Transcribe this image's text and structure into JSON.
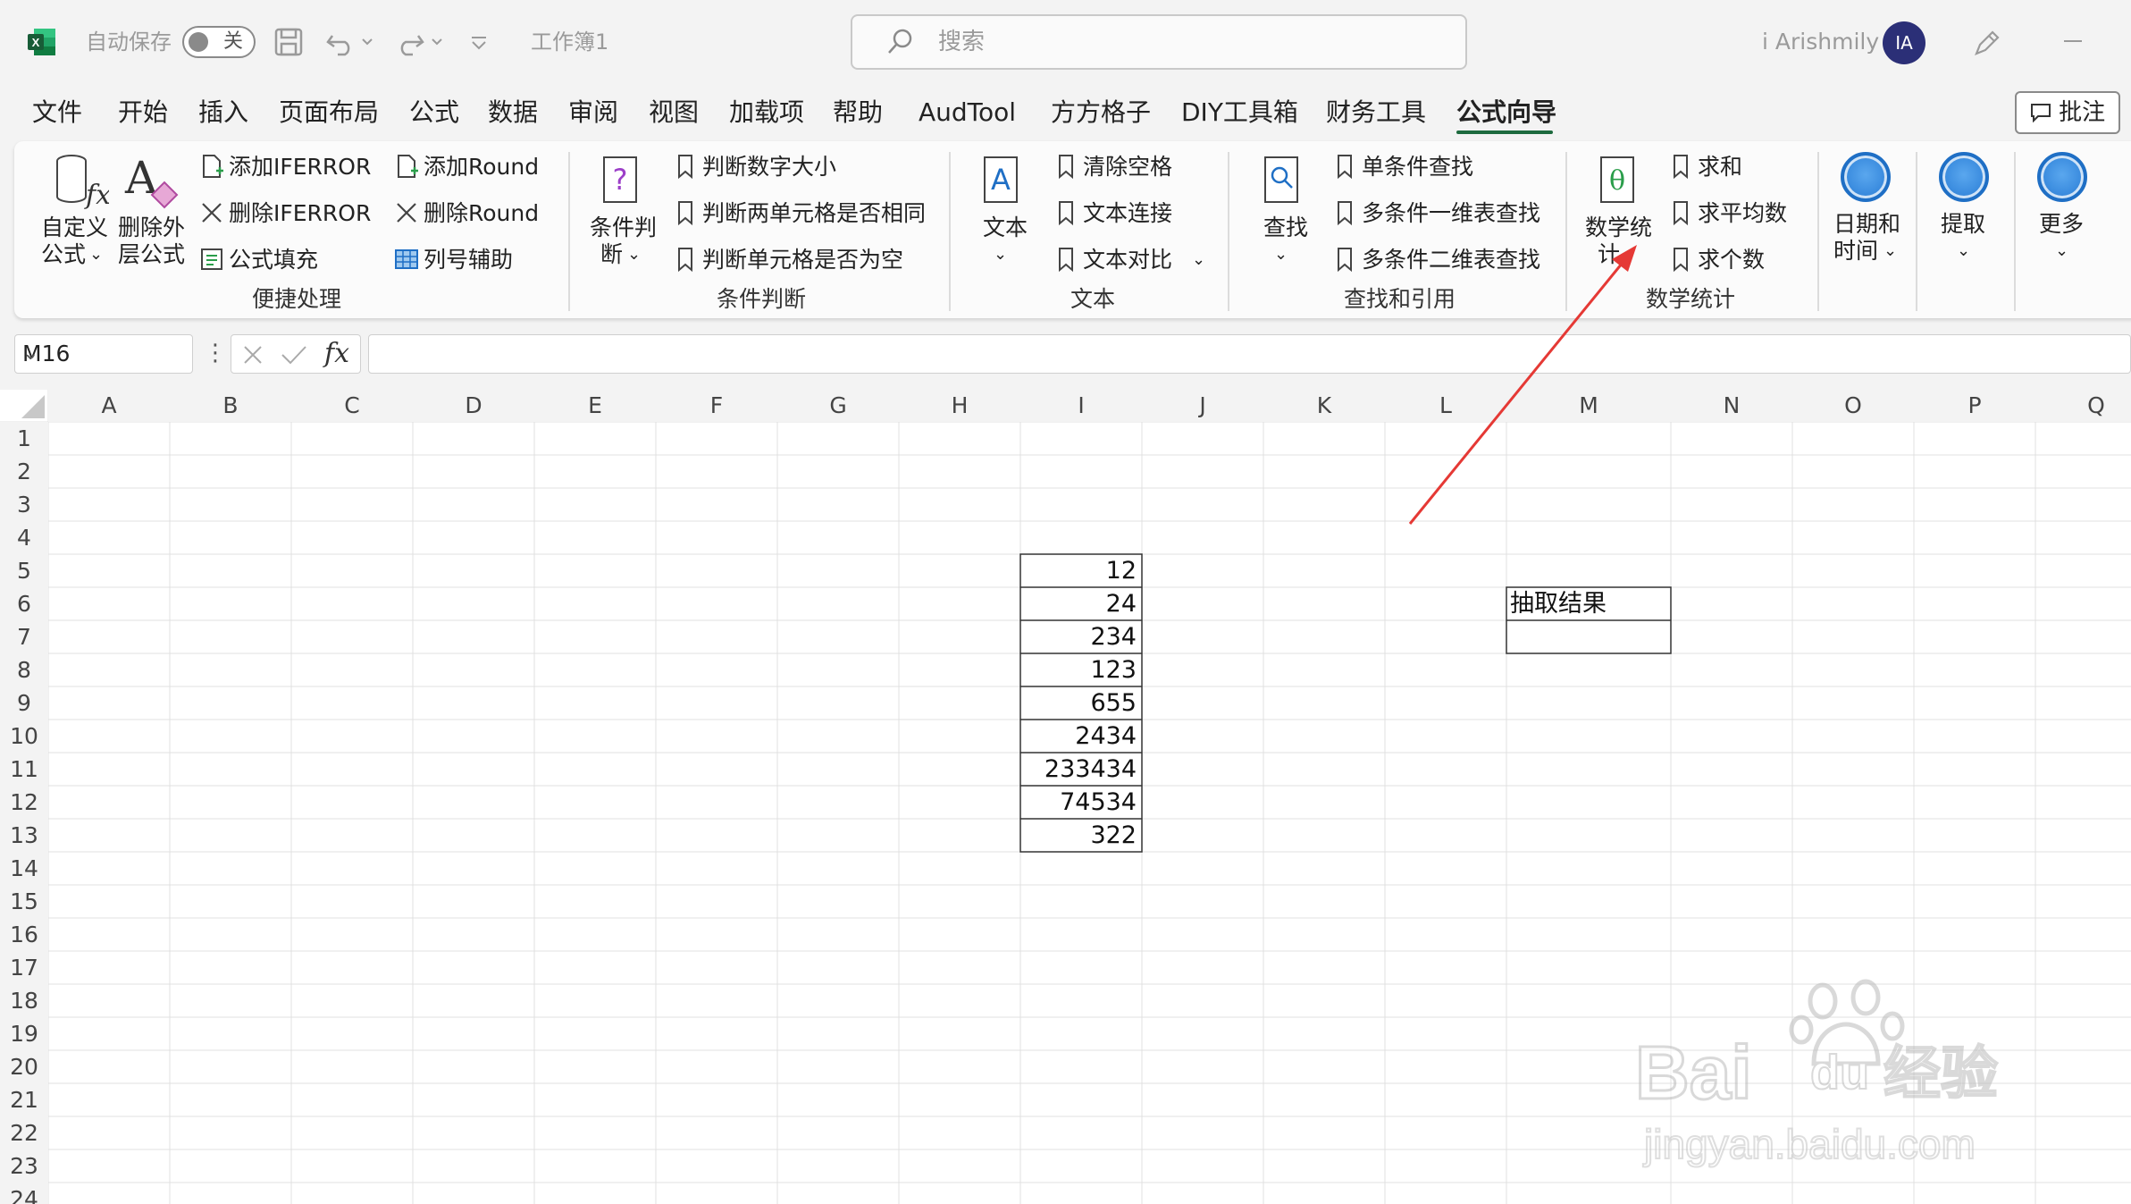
{
  "titlebar": {
    "autosave_label": "自动保存",
    "autosave_state": "关",
    "workbook_name": "工作簿1",
    "search_placeholder": "搜索",
    "user_name": "i Arishmily",
    "avatar_initials": "IA"
  },
  "menu": {
    "items": [
      "文件",
      "开始",
      "插入",
      "页面布局",
      "公式",
      "数据",
      "审阅",
      "视图",
      "加载项",
      "帮助",
      "AudTool",
      "方方格子",
      "DIY工具箱",
      "财务工具",
      "公式向导"
    ],
    "active": "公式向导",
    "comment_button": "批注"
  },
  "ribbon": {
    "groups": {
      "convenience": {
        "label": "便捷处理",
        "custom_formula": [
          "自定义",
          "公式"
        ],
        "remove_outer": [
          "删除外",
          "层公式"
        ],
        "add_iferror": "添加IFERROR",
        "remove_iferror": "删除IFERROR",
        "fill_formula": "公式填充",
        "add_round": "添加Round",
        "remove_round": "删除Round",
        "column_helper": "列号辅助"
      },
      "condition": {
        "label": "条件判断",
        "main": [
          "条件判",
          "断"
        ],
        "judge_size": "判断数字大小",
        "judge_same": "判断两单元格是否相同",
        "judge_empty": "判断单元格是否为空"
      },
      "text": {
        "label": "文本",
        "main": "文本",
        "clear_spaces": "清除空格",
        "text_join": "文本连接",
        "text_compare": "文本对比"
      },
      "lookup": {
        "label": "查找和引用",
        "main": "查找",
        "single": "单条件查找",
        "multi_1d": "多条件一维表查找",
        "multi_2d": "多条件二维表查找"
      },
      "math": {
        "label": "数学统计",
        "main": [
          "数学统",
          "计"
        ],
        "sum": "求和",
        "average": "求平均数",
        "count": "求个数"
      },
      "datetime": {
        "main": [
          "日期和",
          "时间"
        ]
      },
      "extract": {
        "main": "提取"
      },
      "more": {
        "main": "更多"
      }
    }
  },
  "formula_bar": {
    "name_box": "M16",
    "fx": "fx",
    "value": ""
  },
  "grid": {
    "columns": [
      "A",
      "B",
      "C",
      "D",
      "E",
      "F",
      "G",
      "H",
      "I",
      "J",
      "K",
      "L",
      "M",
      "N",
      "O",
      "P",
      "Q"
    ],
    "rows": [
      "1",
      "2",
      "3",
      "4",
      "5",
      "6",
      "7",
      "8",
      "9",
      "10",
      "11",
      "12",
      "13",
      "14",
      "15",
      "16",
      "17",
      "18",
      "19",
      "20",
      "21",
      "22",
      "23",
      "24"
    ],
    "column_i_values": [
      "12",
      "24",
      "234",
      "123",
      "655",
      "2434",
      "233434",
      "74534",
      "322"
    ],
    "m6_label": "抽取结果"
  },
  "watermark": {
    "brand": "Bai",
    "brand_suffix": "经验",
    "url": "jingyan.baidu.com"
  },
  "colors": {
    "excel_green": "#1d6a3e",
    "arrow_red": "#e53935",
    "avatar_navy": "#2b2f77",
    "ribbon_blue": "#3d8ee0"
  }
}
